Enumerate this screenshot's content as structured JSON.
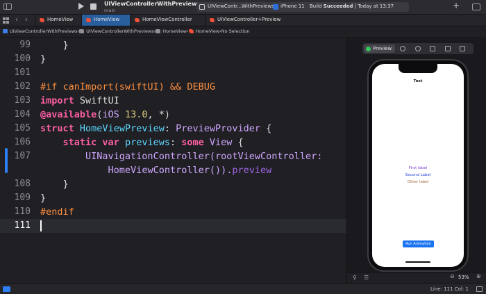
{
  "toolbar": {
    "project_name": "UIViewControllerWithPreviews",
    "branch": "main",
    "scheme": "UIViewContr...WithPreviews",
    "device": "iPhone 11",
    "build_status_prefix": "Build ",
    "build_status_bold": "Succeeded",
    "build_status_suffix": " | Today at 13:37",
    "add_label": "+"
  },
  "tabs": [
    {
      "label": "HomeView",
      "active": false
    },
    {
      "label": "HomeView",
      "active": true
    },
    {
      "label": "HomeViewController",
      "active": false
    },
    {
      "label": "UIViewController+Preview",
      "active": false
    }
  ],
  "nav": {
    "back": "‹",
    "forward": "›"
  },
  "breadcrumb": {
    "project": "UIViewControllerWithPreviews",
    "group": "UIViewControllerWithPreviews",
    "folder": "HomeView",
    "file": "HomeView",
    "selection": "No Selection",
    "separator": "›"
  },
  "editor": {
    "line_numbers": [
      "99",
      "100",
      "101",
      "102",
      "103",
      "104",
      "105",
      "106",
      "107",
      "",
      "108",
      "109",
      "110",
      "111"
    ],
    "current_line": "111",
    "code": {
      "l99": "    }",
      "l100": "}",
      "l102_directive": "#if canImport(swiftUI) && DEBUG",
      "l103_kw": "import",
      "l103_rest": " SwiftUI",
      "l104_attr": "@available",
      "l104_open": "(",
      "l104_platform": "iOS",
      "l104_space": " ",
      "l104_version": "13.0",
      "l104_close": ", *)",
      "l105_kw": "struct",
      "l105_space": " ",
      "l105_name": "HomeViewPreview",
      "l105_colon": ": ",
      "l105_proto": "PreviewProvider",
      "l105_brace": " {",
      "l106_indent": "    ",
      "l106_kw": "static var",
      "l106_space": " ",
      "l106_name": "previews",
      "l106_colon": ": ",
      "l106_some": "some",
      "l106_space2": " ",
      "l106_type": "View",
      "l106_brace": " {",
      "l107_indent": "        ",
      "l107_call": "UINavigationController(rootViewController:",
      "l107b_indent": "            ",
      "l107b_call": "HomeViewController()).",
      "l107b_member": "preview",
      "l108": "    }",
      "l109": "}",
      "l110_directive": "#endif"
    }
  },
  "preview": {
    "button_label": "Preview",
    "nav_title": "Test",
    "first_label": "First label",
    "second_label": "Second Label",
    "other_label": "Other label",
    "run_button": "Run Animation",
    "zoom": "53%",
    "zoom_out": "⊖",
    "zoom_in": "⊕",
    "pin": "⚲",
    "variants": "☰"
  },
  "status": {
    "cursor_position": "Line: 111  Col: 1"
  },
  "colors": {
    "accent": "#2f7ff5",
    "keyword": "#fc5fa3",
    "preprocessor": "#fd8f3f",
    "type": "#d0a8ff",
    "number": "#d9c97c",
    "declaration": "#5dd8ff",
    "member": "#a167e6",
    "live": "#34c759"
  }
}
